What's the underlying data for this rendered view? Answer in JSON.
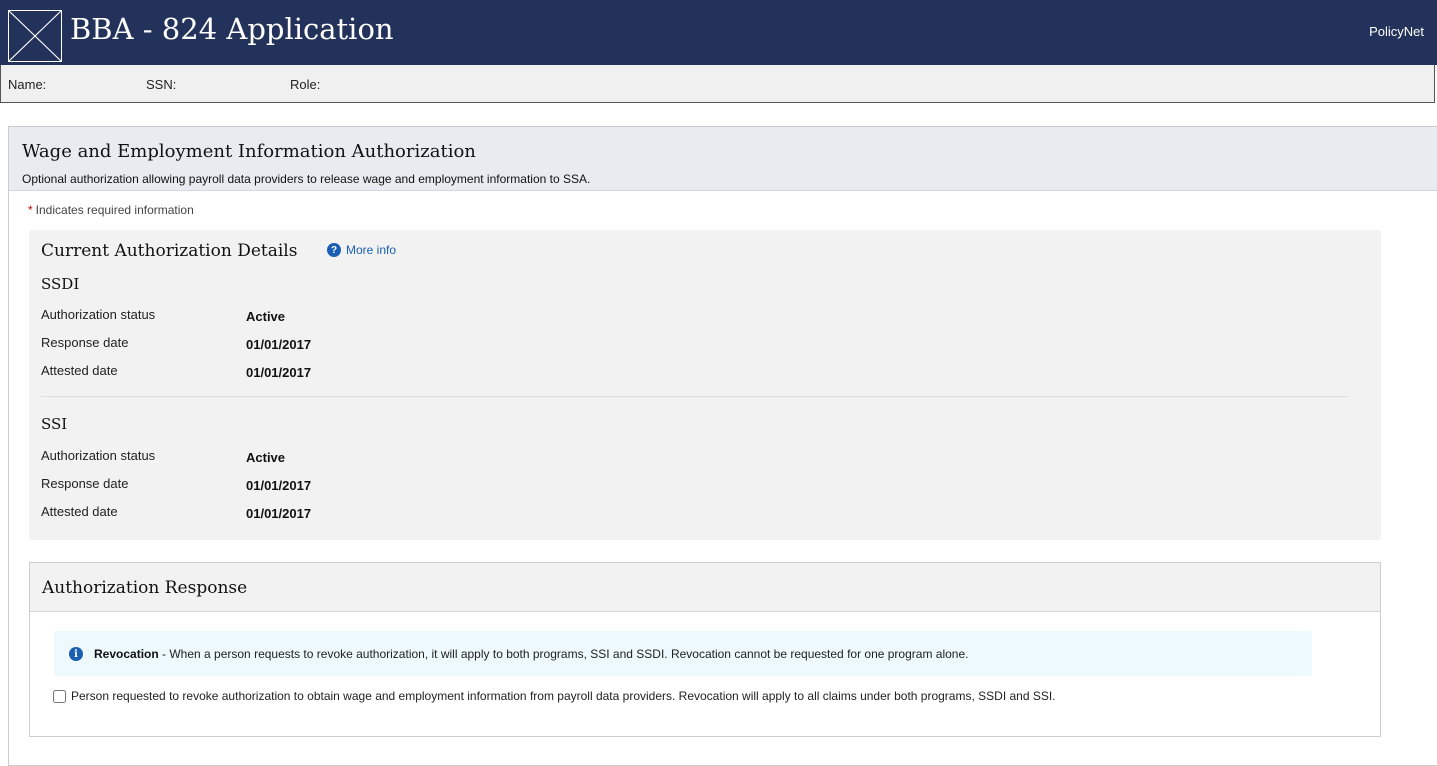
{
  "header": {
    "title": "BBA - 824 Application",
    "logo_icon": "broken-image-icon",
    "link": "PolicyNet",
    "background": "#23325a"
  },
  "user_bar": {
    "name_label": "Name:",
    "ssn_label": "SSN:",
    "role_label": "Role:"
  },
  "page": {
    "title": "Wage and Employment Information Authorization",
    "subtitle": "Optional authorization allowing payroll data providers to release wage and employment information to SSA.",
    "required_star": "*",
    "required_note": "Indicates required information"
  },
  "details": {
    "title": "Current Authorization Details",
    "more_info": "More info",
    "more_info_icon": "help-icon",
    "programs": [
      {
        "name": "SSDI",
        "fields": [
          {
            "label": "Authorization status",
            "value": "Active"
          },
          {
            "label": "Response date",
            "value": "01/01/2017"
          },
          {
            "label": "Attested date",
            "value": "01/01/2017"
          }
        ]
      },
      {
        "name": "SSI",
        "fields": [
          {
            "label": "Authorization status",
            "value": "Active"
          },
          {
            "label": "Response date",
            "value": "01/01/2017"
          },
          {
            "label": "Attested date",
            "value": "01/01/2017"
          }
        ]
      }
    ]
  },
  "response": {
    "title": "Authorization Response",
    "info_icon": "info-icon",
    "info_bold": "Revocation",
    "info_text": " - When a person requests to revoke authorization, it will apply to both programs, SSI and SSDI. Revocation cannot be requested for one program alone.",
    "checkbox_label": "Person requested to revoke authorization to obtain wage and employment information from payroll data providers. Revocation will apply to all claims under both programs, SSDI and SSI.",
    "checkbox_checked": false
  }
}
